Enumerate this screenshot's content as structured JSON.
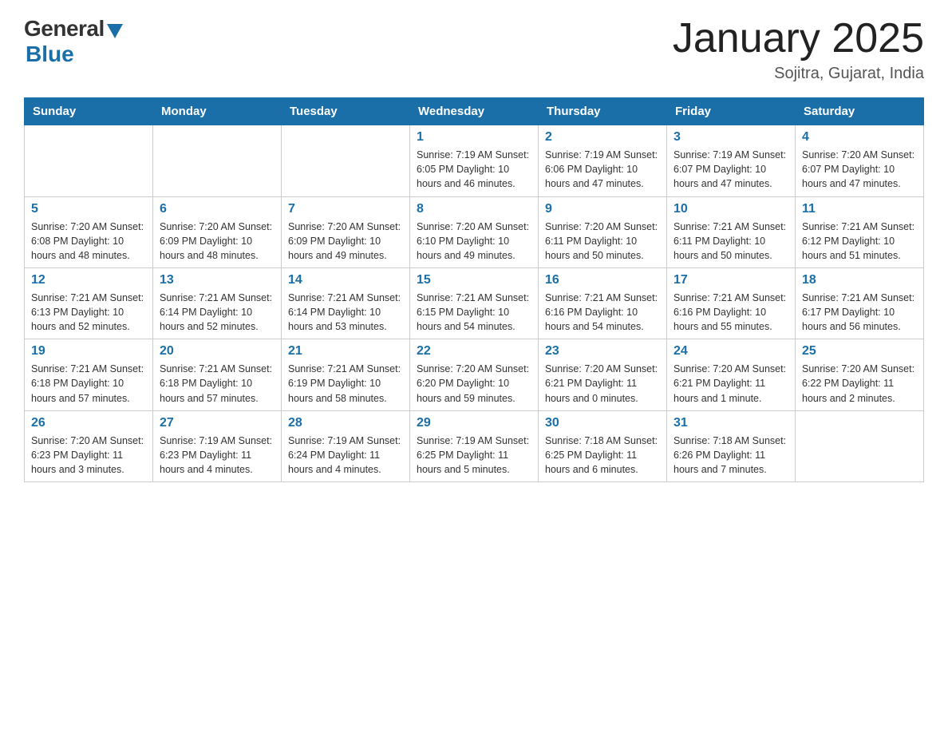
{
  "logo": {
    "general": "General",
    "blue": "Blue"
  },
  "title": "January 2025",
  "location": "Sojitra, Gujarat, India",
  "days_of_week": [
    "Sunday",
    "Monday",
    "Tuesday",
    "Wednesday",
    "Thursday",
    "Friday",
    "Saturday"
  ],
  "weeks": [
    [
      {
        "day": "",
        "info": ""
      },
      {
        "day": "",
        "info": ""
      },
      {
        "day": "",
        "info": ""
      },
      {
        "day": "1",
        "info": "Sunrise: 7:19 AM\nSunset: 6:05 PM\nDaylight: 10 hours\nand 46 minutes."
      },
      {
        "day": "2",
        "info": "Sunrise: 7:19 AM\nSunset: 6:06 PM\nDaylight: 10 hours\nand 47 minutes."
      },
      {
        "day": "3",
        "info": "Sunrise: 7:19 AM\nSunset: 6:07 PM\nDaylight: 10 hours\nand 47 minutes."
      },
      {
        "day": "4",
        "info": "Sunrise: 7:20 AM\nSunset: 6:07 PM\nDaylight: 10 hours\nand 47 minutes."
      }
    ],
    [
      {
        "day": "5",
        "info": "Sunrise: 7:20 AM\nSunset: 6:08 PM\nDaylight: 10 hours\nand 48 minutes."
      },
      {
        "day": "6",
        "info": "Sunrise: 7:20 AM\nSunset: 6:09 PM\nDaylight: 10 hours\nand 48 minutes."
      },
      {
        "day": "7",
        "info": "Sunrise: 7:20 AM\nSunset: 6:09 PM\nDaylight: 10 hours\nand 49 minutes."
      },
      {
        "day": "8",
        "info": "Sunrise: 7:20 AM\nSunset: 6:10 PM\nDaylight: 10 hours\nand 49 minutes."
      },
      {
        "day": "9",
        "info": "Sunrise: 7:20 AM\nSunset: 6:11 PM\nDaylight: 10 hours\nand 50 minutes."
      },
      {
        "day": "10",
        "info": "Sunrise: 7:21 AM\nSunset: 6:11 PM\nDaylight: 10 hours\nand 50 minutes."
      },
      {
        "day": "11",
        "info": "Sunrise: 7:21 AM\nSunset: 6:12 PM\nDaylight: 10 hours\nand 51 minutes."
      }
    ],
    [
      {
        "day": "12",
        "info": "Sunrise: 7:21 AM\nSunset: 6:13 PM\nDaylight: 10 hours\nand 52 minutes."
      },
      {
        "day": "13",
        "info": "Sunrise: 7:21 AM\nSunset: 6:14 PM\nDaylight: 10 hours\nand 52 minutes."
      },
      {
        "day": "14",
        "info": "Sunrise: 7:21 AM\nSunset: 6:14 PM\nDaylight: 10 hours\nand 53 minutes."
      },
      {
        "day": "15",
        "info": "Sunrise: 7:21 AM\nSunset: 6:15 PM\nDaylight: 10 hours\nand 54 minutes."
      },
      {
        "day": "16",
        "info": "Sunrise: 7:21 AM\nSunset: 6:16 PM\nDaylight: 10 hours\nand 54 minutes."
      },
      {
        "day": "17",
        "info": "Sunrise: 7:21 AM\nSunset: 6:16 PM\nDaylight: 10 hours\nand 55 minutes."
      },
      {
        "day": "18",
        "info": "Sunrise: 7:21 AM\nSunset: 6:17 PM\nDaylight: 10 hours\nand 56 minutes."
      }
    ],
    [
      {
        "day": "19",
        "info": "Sunrise: 7:21 AM\nSunset: 6:18 PM\nDaylight: 10 hours\nand 57 minutes."
      },
      {
        "day": "20",
        "info": "Sunrise: 7:21 AM\nSunset: 6:18 PM\nDaylight: 10 hours\nand 57 minutes."
      },
      {
        "day": "21",
        "info": "Sunrise: 7:21 AM\nSunset: 6:19 PM\nDaylight: 10 hours\nand 58 minutes."
      },
      {
        "day": "22",
        "info": "Sunrise: 7:20 AM\nSunset: 6:20 PM\nDaylight: 10 hours\nand 59 minutes."
      },
      {
        "day": "23",
        "info": "Sunrise: 7:20 AM\nSunset: 6:21 PM\nDaylight: 11 hours\nand 0 minutes."
      },
      {
        "day": "24",
        "info": "Sunrise: 7:20 AM\nSunset: 6:21 PM\nDaylight: 11 hours\nand 1 minute."
      },
      {
        "day": "25",
        "info": "Sunrise: 7:20 AM\nSunset: 6:22 PM\nDaylight: 11 hours\nand 2 minutes."
      }
    ],
    [
      {
        "day": "26",
        "info": "Sunrise: 7:20 AM\nSunset: 6:23 PM\nDaylight: 11 hours\nand 3 minutes."
      },
      {
        "day": "27",
        "info": "Sunrise: 7:19 AM\nSunset: 6:23 PM\nDaylight: 11 hours\nand 4 minutes."
      },
      {
        "day": "28",
        "info": "Sunrise: 7:19 AM\nSunset: 6:24 PM\nDaylight: 11 hours\nand 4 minutes."
      },
      {
        "day": "29",
        "info": "Sunrise: 7:19 AM\nSunset: 6:25 PM\nDaylight: 11 hours\nand 5 minutes."
      },
      {
        "day": "30",
        "info": "Sunrise: 7:18 AM\nSunset: 6:25 PM\nDaylight: 11 hours\nand 6 minutes."
      },
      {
        "day": "31",
        "info": "Sunrise: 7:18 AM\nSunset: 6:26 PM\nDaylight: 11 hours\nand 7 minutes."
      },
      {
        "day": "",
        "info": ""
      }
    ]
  ]
}
